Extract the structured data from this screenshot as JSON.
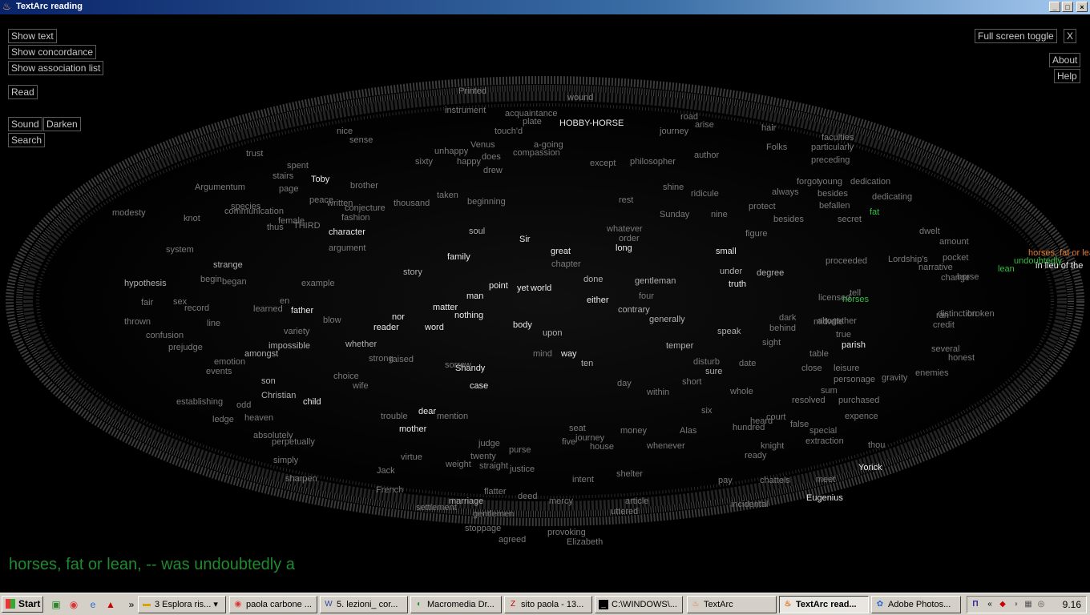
{
  "window": {
    "title": "TextArc reading",
    "minimize": "_",
    "maximize": "□",
    "close": "×"
  },
  "controls": {
    "show_text": "Show text",
    "show_concordance": "Show concordance",
    "show_association_list": "Show association list",
    "read": "Read",
    "sound": "Sound",
    "darken": "Darken",
    "search": "Search",
    "full_screen_toggle": "Full screen toggle",
    "close_x": "X",
    "about": "About",
    "help": "Help"
  },
  "reading_line": "horses, fat or lean, -- was undoubtedly a",
  "arc_words": [
    {
      "t": "HOBBY-HORSE",
      "c": "hi"
    },
    {
      "t": "wound",
      "c": "n"
    },
    {
      "t": "instrument",
      "c": "n"
    },
    {
      "t": "acquaintance",
      "c": "n"
    },
    {
      "t": "Venus",
      "c": "n"
    },
    {
      "t": "compassion",
      "c": "n"
    },
    {
      "t": "character",
      "c": "hi"
    },
    {
      "t": "argument",
      "c": "n"
    },
    {
      "t": "brother",
      "c": "n"
    },
    {
      "t": "Toby",
      "c": "hi"
    },
    {
      "t": "family",
      "c": "hi"
    },
    {
      "t": "great",
      "c": "hi"
    },
    {
      "t": "long",
      "c": "hi"
    },
    {
      "t": "small",
      "c": "hi"
    },
    {
      "t": "father",
      "c": "hi"
    },
    {
      "t": "matter",
      "c": "hi"
    },
    {
      "t": "nothing",
      "c": "hi"
    },
    {
      "t": "word",
      "c": "hi"
    },
    {
      "t": "body",
      "c": "hi"
    },
    {
      "t": "reader",
      "c": "hi"
    },
    {
      "t": "Shandy",
      "c": "hi"
    },
    {
      "t": "case",
      "c": "hi"
    },
    {
      "t": "child",
      "c": "hi"
    },
    {
      "t": "mother",
      "c": "hi"
    },
    {
      "t": "dear",
      "c": "hi"
    },
    {
      "t": "Yorick",
      "c": "hi"
    },
    {
      "t": "Eugenius",
      "c": "hi"
    },
    {
      "t": "parish",
      "c": "hi"
    },
    {
      "t": "truth",
      "c": "hi"
    },
    {
      "t": "world",
      "c": "hi"
    },
    {
      "t": "strange",
      "c": "mid"
    },
    {
      "t": "hypothesis",
      "c": "mid"
    },
    {
      "t": "modesty",
      "c": "n"
    },
    {
      "t": "Argumentum",
      "c": "n"
    },
    {
      "t": "species",
      "c": "n"
    },
    {
      "t": "thus",
      "c": "n"
    },
    {
      "t": "system",
      "c": "n"
    },
    {
      "t": "knot",
      "c": "n"
    },
    {
      "t": "learned",
      "c": "n"
    },
    {
      "t": "whether",
      "c": "mid"
    },
    {
      "t": "impossible",
      "c": "mid"
    },
    {
      "t": "amongst",
      "c": "mid"
    },
    {
      "t": "son",
      "c": "mid"
    },
    {
      "t": "Christian",
      "c": "mid"
    },
    {
      "t": "heaven",
      "c": "n"
    },
    {
      "t": "absolutely",
      "c": "n"
    },
    {
      "t": "simply",
      "c": "n"
    },
    {
      "t": "marriage",
      "c": "mid"
    },
    {
      "t": "settlement",
      "c": "n"
    },
    {
      "t": "justice",
      "c": "n"
    },
    {
      "t": "intent",
      "c": "n"
    },
    {
      "t": "article",
      "c": "n"
    },
    {
      "t": "journey",
      "c": "n"
    },
    {
      "t": "money",
      "c": "n"
    },
    {
      "t": "ready",
      "c": "n"
    },
    {
      "t": "thou",
      "c": "n"
    },
    {
      "t": "meet",
      "c": "n"
    },
    {
      "t": "expence",
      "c": "n"
    },
    {
      "t": "gravity",
      "c": "n"
    },
    {
      "t": "enemies",
      "c": "n"
    },
    {
      "t": "honest",
      "c": "n"
    },
    {
      "t": "besides",
      "c": "n"
    },
    {
      "t": "figure",
      "c": "n"
    },
    {
      "t": "nine",
      "c": "n"
    },
    {
      "t": "rest",
      "c": "n"
    },
    {
      "t": "chapter",
      "c": "n"
    },
    {
      "t": "midwife",
      "c": "n"
    },
    {
      "t": "dark",
      "c": "n"
    },
    {
      "t": "behind",
      "c": "n"
    },
    {
      "t": "horse",
      "c": "n"
    },
    {
      "t": "pocket",
      "c": "n"
    },
    {
      "t": "young",
      "c": "n"
    },
    {
      "t": "dedication",
      "c": "n"
    },
    {
      "t": "always",
      "c": "n"
    },
    {
      "t": "protect",
      "c": "n"
    },
    {
      "t": "philosopher",
      "c": "n"
    },
    {
      "t": "author",
      "c": "n"
    },
    {
      "t": "faculties",
      "c": "n"
    },
    {
      "t": "purchased",
      "c": "n"
    },
    {
      "t": "resolved",
      "c": "n"
    },
    {
      "t": "sum",
      "c": "n"
    },
    {
      "t": "personage",
      "c": "n"
    },
    {
      "t": "leisure",
      "c": "n"
    },
    {
      "t": "hundred",
      "c": "n"
    },
    {
      "t": "special",
      "c": "n"
    },
    {
      "t": "extraction",
      "c": "n"
    },
    {
      "t": "knight",
      "c": "n"
    },
    {
      "t": "pay",
      "c": "n"
    },
    {
      "t": "chattels",
      "c": "n"
    },
    {
      "t": "incidental",
      "c": "n"
    },
    {
      "t": "uttered",
      "c": "n"
    },
    {
      "t": "mercy",
      "c": "n"
    },
    {
      "t": "deed",
      "c": "n"
    },
    {
      "t": "flatter",
      "c": "n"
    },
    {
      "t": "French",
      "c": "n"
    },
    {
      "t": "gentlemen",
      "c": "n"
    },
    {
      "t": "provoking",
      "c": "n"
    },
    {
      "t": "Elizabeth",
      "c": "n"
    },
    {
      "t": "agreed",
      "c": "n"
    },
    {
      "t": "stoppage",
      "c": "n"
    },
    {
      "t": "unhappy",
      "c": "n"
    },
    {
      "t": "sixty",
      "c": "n"
    },
    {
      "t": "spent",
      "c": "n"
    },
    {
      "t": "trust",
      "c": "n"
    },
    {
      "t": "nice",
      "c": "n"
    },
    {
      "t": "sense",
      "c": "n"
    },
    {
      "t": "fashion",
      "c": "n"
    },
    {
      "t": "conjecture",
      "c": "n"
    },
    {
      "t": "beginning",
      "c": "n"
    },
    {
      "t": "whatever",
      "c": "n"
    },
    {
      "t": "order",
      "c": "n"
    },
    {
      "t": "Sunday",
      "c": "n"
    },
    {
      "t": "shine",
      "c": "n"
    },
    {
      "t": "ridicule",
      "c": "n"
    },
    {
      "t": "except",
      "c": "n"
    },
    {
      "t": "hair",
      "c": "n"
    },
    {
      "t": "road",
      "c": "n"
    },
    {
      "t": "horses",
      "c": "green"
    },
    {
      "t": "fat",
      "c": "green"
    },
    {
      "t": "undoubtedly",
      "c": "green"
    },
    {
      "t": "lean",
      "c": "green"
    },
    {
      "t": "horses, fat or lean",
      "c": "orange"
    },
    {
      "t": "in lieu of the",
      "c": "hi"
    },
    {
      "t": "secret",
      "c": "n"
    },
    {
      "t": "dwelt",
      "c": "n"
    },
    {
      "t": "amount",
      "c": "n"
    },
    {
      "t": "proceeded",
      "c": "n"
    },
    {
      "t": "Lordship's",
      "c": "n"
    },
    {
      "t": "narrative",
      "c": "n"
    },
    {
      "t": "change",
      "c": "n"
    },
    {
      "t": "credit",
      "c": "n"
    },
    {
      "t": "distinction",
      "c": "n"
    },
    {
      "t": "broken",
      "c": "n"
    },
    {
      "t": "several",
      "c": "n"
    },
    {
      "t": "true",
      "c": "n"
    },
    {
      "t": "altogether",
      "c": "n"
    },
    {
      "t": "sight",
      "c": "n"
    },
    {
      "t": "table",
      "c": "n"
    },
    {
      "t": "close",
      "c": "n"
    },
    {
      "t": "court",
      "c": "n"
    },
    {
      "t": "false",
      "c": "n"
    },
    {
      "t": "heard",
      "c": "n"
    },
    {
      "t": "whole",
      "c": "n"
    },
    {
      "t": "within",
      "c": "n"
    },
    {
      "t": "day",
      "c": "n"
    },
    {
      "t": "short",
      "c": "n"
    },
    {
      "t": "six",
      "c": "n"
    },
    {
      "t": "Alas",
      "c": "n"
    },
    {
      "t": "whenever",
      "c": "n"
    },
    {
      "t": "shelter",
      "c": "n"
    },
    {
      "t": "house",
      "c": "n"
    },
    {
      "t": "five",
      "c": "n"
    },
    {
      "t": "seat",
      "c": "n"
    },
    {
      "t": "purse",
      "c": "n"
    },
    {
      "t": "judge",
      "c": "n"
    },
    {
      "t": "twenty",
      "c": "n"
    },
    {
      "t": "weight",
      "c": "n"
    },
    {
      "t": "straight",
      "c": "n"
    },
    {
      "t": "virtue",
      "c": "n"
    },
    {
      "t": "Jack",
      "c": "n"
    },
    {
      "t": "trouble",
      "c": "n"
    },
    {
      "t": "mention",
      "c": "n"
    },
    {
      "t": "raised",
      "c": "n"
    },
    {
      "t": "strong",
      "c": "n"
    },
    {
      "t": "sorrow",
      "c": "n"
    },
    {
      "t": "mind",
      "c": "n"
    },
    {
      "t": "yet",
      "c": "hi"
    },
    {
      "t": "man",
      "c": "hi"
    },
    {
      "t": "point",
      "c": "hi"
    },
    {
      "t": "story",
      "c": "mid"
    },
    {
      "t": "Sir",
      "c": "hi"
    },
    {
      "t": "soul",
      "c": "mid"
    },
    {
      "t": "done",
      "c": "mid"
    },
    {
      "t": "either",
      "c": "hi"
    },
    {
      "t": "contrary",
      "c": "mid"
    },
    {
      "t": "generally",
      "c": "mid"
    },
    {
      "t": "speak",
      "c": "mid"
    },
    {
      "t": "under",
      "c": "mid"
    },
    {
      "t": "degree",
      "c": "mid"
    },
    {
      "t": "four",
      "c": "n"
    },
    {
      "t": "gentleman",
      "c": "mid"
    },
    {
      "t": "upon",
      "c": "mid"
    },
    {
      "t": "way",
      "c": "hi"
    },
    {
      "t": "temper",
      "c": "mid"
    },
    {
      "t": "ten",
      "c": "mid"
    },
    {
      "t": "sure",
      "c": "mid"
    },
    {
      "t": "date",
      "c": "n"
    },
    {
      "t": "disturb",
      "c": "n"
    },
    {
      "t": "record",
      "c": "n"
    },
    {
      "t": "fair",
      "c": "n"
    },
    {
      "t": "sex",
      "c": "n"
    },
    {
      "t": "en",
      "c": "n"
    },
    {
      "t": "line",
      "c": "n"
    },
    {
      "t": "confusion",
      "c": "n"
    },
    {
      "t": "prejudge",
      "c": "n"
    },
    {
      "t": "emotion",
      "c": "n"
    },
    {
      "t": "events",
      "c": "n"
    },
    {
      "t": "ledge",
      "c": "n"
    },
    {
      "t": "odd",
      "c": "n"
    },
    {
      "t": "establishing",
      "c": "n"
    },
    {
      "t": "perpetually",
      "c": "n"
    },
    {
      "t": "sharpen",
      "c": "n"
    },
    {
      "t": "nor",
      "c": "hi"
    },
    {
      "t": "begin",
      "c": "n"
    },
    {
      "t": "example",
      "c": "n"
    },
    {
      "t": "began",
      "c": "n"
    },
    {
      "t": "thrown",
      "c": "n"
    },
    {
      "t": "blow",
      "c": "n"
    },
    {
      "t": "variety",
      "c": "n"
    },
    {
      "t": "choice",
      "c": "n"
    },
    {
      "t": "wife",
      "c": "n"
    },
    {
      "t": "THIRD",
      "c": "n"
    },
    {
      "t": "female",
      "c": "n"
    },
    {
      "t": "communication",
      "c": "n"
    },
    {
      "t": "stairs",
      "c": "n"
    },
    {
      "t": "page",
      "c": "n"
    },
    {
      "t": "peace",
      "c": "n"
    },
    {
      "t": "written",
      "c": "n"
    },
    {
      "t": "thousand",
      "c": "n"
    },
    {
      "t": "taken",
      "c": "n"
    },
    {
      "t": "happy",
      "c": "n"
    },
    {
      "t": "does",
      "c": "n"
    },
    {
      "t": "drew",
      "c": "n"
    },
    {
      "t": "a-going",
      "c": "n"
    },
    {
      "t": "touch'd",
      "c": "n"
    },
    {
      "t": "Printed",
      "c": "n"
    },
    {
      "t": "plate",
      "c": "n"
    },
    {
      "t": "journey",
      "c": "n"
    },
    {
      "t": "arise",
      "c": "n"
    },
    {
      "t": "Folks",
      "c": "n"
    },
    {
      "t": "particularly",
      "c": "n"
    },
    {
      "t": "preceding",
      "c": "n"
    },
    {
      "t": "forgot",
      "c": "n"
    },
    {
      "t": "besides",
      "c": "n"
    },
    {
      "t": "befallen",
      "c": "n"
    },
    {
      "t": "dedicating",
      "c": "n"
    },
    {
      "t": "ran",
      "c": "n"
    },
    {
      "t": "tell",
      "c": "n"
    },
    {
      "t": "licensed",
      "c": "n"
    }
  ]
}
